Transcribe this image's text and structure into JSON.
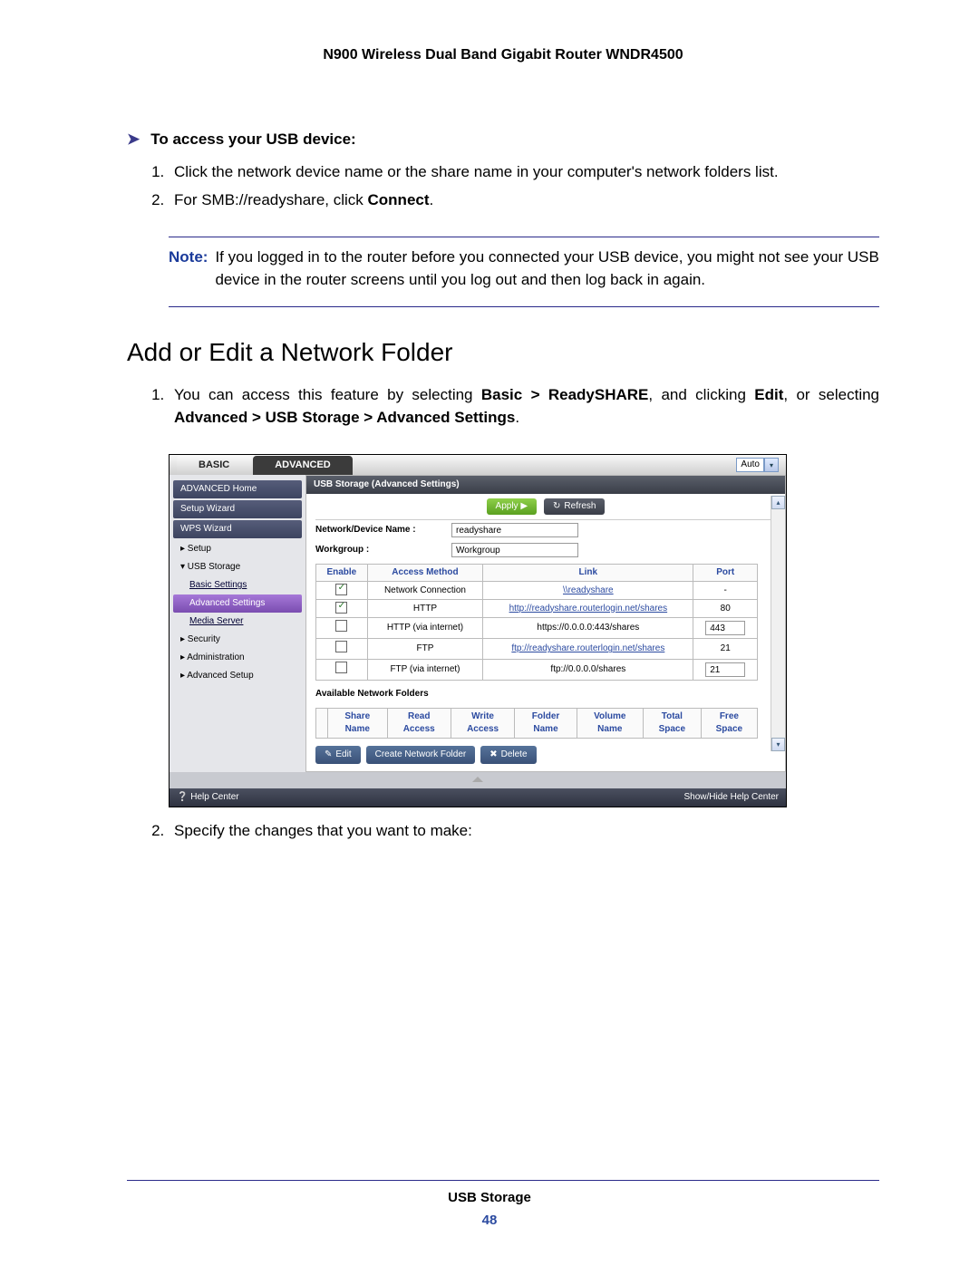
{
  "header_title": "N900 Wireless Dual Band Gigabit Router WNDR4500",
  "intro_heading": "To access your USB device:",
  "intro_steps": [
    {
      "pre": "Click the network device name or the share name in your computer's network folders list."
    },
    {
      "pre": "For SMB://readyshare, click ",
      "bold": "Connect",
      "post": "."
    }
  ],
  "note_label": "Note:",
  "note_text": "If you logged in to the router before you connected your USB device, you might not see your USB device in the router screens until you log out and then log back in again.",
  "section_title": "Add or Edit a Network Folder",
  "section_steps_1_pre": "You can access this feature by selecting ",
  "section_steps_1_b1": "Basic > ReadySHARE",
  "section_steps_1_mid": ", and clicking ",
  "section_steps_1_b2": "Edit",
  "section_steps_1_mid2": ", or selecting ",
  "section_steps_1_b3": "Advanced > USB Storage > Advanced Settings",
  "section_steps_1_post": ".",
  "section_step2": "Specify the changes that you want to make:",
  "ui": {
    "tab_basic": "BASIC",
    "tab_advanced": "ADVANCED",
    "auto_label": "Auto",
    "content_header": "USB Storage (Advanced Settings)",
    "btn_apply": "Apply ▶",
    "btn_refresh": "Refresh",
    "form": {
      "devname_label": "Network/Device Name :",
      "devname_value": "readyshare",
      "wg_label": "Workgroup :",
      "wg_value": "Workgroup"
    },
    "table": {
      "headers": [
        "Enable",
        "Access Method",
        "Link",
        "Port"
      ],
      "rows": [
        {
          "enabled": true,
          "method": "Network Connection",
          "link": "\\\\readyshare",
          "port": "-",
          "islink": true
        },
        {
          "enabled": true,
          "method": "HTTP",
          "link": "http://readyshare.routerlogin.net/shares",
          "port": "80",
          "islink": true
        },
        {
          "enabled": false,
          "method": "HTTP (via internet)",
          "link": "https://0.0.0.0:443/shares",
          "port": "443",
          "islink": false,
          "portinput": true
        },
        {
          "enabled": false,
          "method": "FTP",
          "link": "ftp://readyshare.routerlogin.net/shares",
          "port": "21",
          "islink": true
        },
        {
          "enabled": false,
          "method": "FTP (via internet)",
          "link": "ftp://0.0.0.0/shares",
          "port": "21",
          "islink": false,
          "portinput": true
        }
      ]
    },
    "avail_label": "Available Network Folders",
    "folder_headers": [
      "",
      "Share Name",
      "Read Access",
      "Write Access",
      "Folder Name",
      "Volume Name",
      "Total Space",
      "Free Space"
    ],
    "btn_edit": "Edit",
    "btn_create": "Create Network Folder",
    "btn_delete": "Delete",
    "help_center": "Help Center",
    "show_hide": "Show/Hide Help Center",
    "nav": {
      "adv_home": "ADVANCED Home",
      "setup_wiz": "Setup Wizard",
      "wps_wiz": "WPS Wizard",
      "setup": "▸ Setup",
      "usb": "▾ USB Storage",
      "basic_set": "Basic Settings",
      "adv_set": "Advanced Settings",
      "media": "Media Server",
      "security": "▸ Security",
      "admin": "▸ Administration",
      "adv_setup": "▸ Advanced Setup"
    }
  },
  "footer_title": "USB Storage",
  "footer_page": "48"
}
